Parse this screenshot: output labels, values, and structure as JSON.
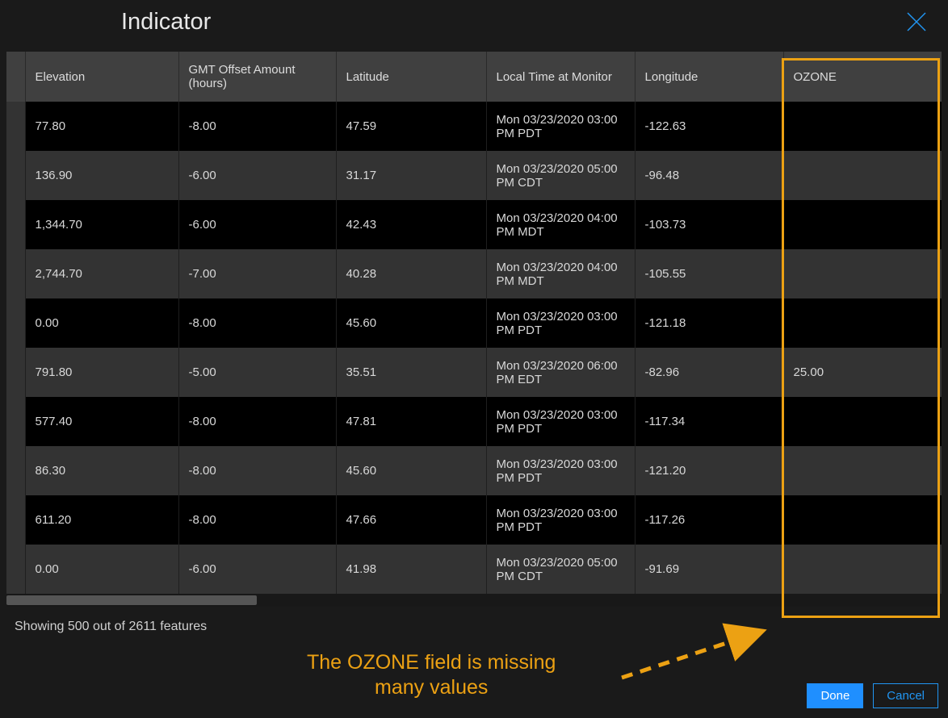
{
  "dialog": {
    "title": "Indicator",
    "done_label": "Done",
    "cancel_label": "Cancel"
  },
  "table": {
    "columns": [
      "Elevation",
      "GMT Offset Amount (hours)",
      "Latitude",
      "Local Time at Monitor",
      "Longitude",
      "OZONE"
    ],
    "rows": [
      {
        "elevation": "77.80",
        "gmt_offset": "-8.00",
        "latitude": "47.59",
        "local_time": "Mon 03/23/2020 03:00 PM PDT",
        "longitude": "-122.63",
        "ozone": ""
      },
      {
        "elevation": "136.90",
        "gmt_offset": "-6.00",
        "latitude": "31.17",
        "local_time": "Mon 03/23/2020 05:00 PM CDT",
        "longitude": "-96.48",
        "ozone": ""
      },
      {
        "elevation": "1,344.70",
        "gmt_offset": "-6.00",
        "latitude": "42.43",
        "local_time": "Mon 03/23/2020 04:00 PM MDT",
        "longitude": "-103.73",
        "ozone": ""
      },
      {
        "elevation": "2,744.70",
        "gmt_offset": "-7.00",
        "latitude": "40.28",
        "local_time": "Mon 03/23/2020 04:00 PM MDT",
        "longitude": "-105.55",
        "ozone": ""
      },
      {
        "elevation": "0.00",
        "gmt_offset": "-8.00",
        "latitude": "45.60",
        "local_time": "Mon 03/23/2020 03:00 PM PDT",
        "longitude": "-121.18",
        "ozone": ""
      },
      {
        "elevation": "791.80",
        "gmt_offset": "-5.00",
        "latitude": "35.51",
        "local_time": "Mon 03/23/2020 06:00 PM EDT",
        "longitude": "-82.96",
        "ozone": "25.00"
      },
      {
        "elevation": "577.40",
        "gmt_offset": "-8.00",
        "latitude": "47.81",
        "local_time": "Mon 03/23/2020 03:00 PM PDT",
        "longitude": "-117.34",
        "ozone": ""
      },
      {
        "elevation": "86.30",
        "gmt_offset": "-8.00",
        "latitude": "45.60",
        "local_time": "Mon 03/23/2020 03:00 PM PDT",
        "longitude": "-121.20",
        "ozone": ""
      },
      {
        "elevation": "611.20",
        "gmt_offset": "-8.00",
        "latitude": "47.66",
        "local_time": "Mon 03/23/2020 03:00 PM PDT",
        "longitude": "-117.26",
        "ozone": ""
      },
      {
        "elevation": "0.00",
        "gmt_offset": "-6.00",
        "latitude": "41.98",
        "local_time": "Mon 03/23/2020 05:00 PM CDT",
        "longitude": "-91.69",
        "ozone": ""
      }
    ]
  },
  "status": {
    "text": "Showing 500 out of 2611 features"
  },
  "annotation": {
    "line1": "The OZONE field is missing",
    "line2": "many values"
  },
  "colors": {
    "highlight": "#eca113",
    "primary": "#1f8fff",
    "link": "#2196f3"
  }
}
